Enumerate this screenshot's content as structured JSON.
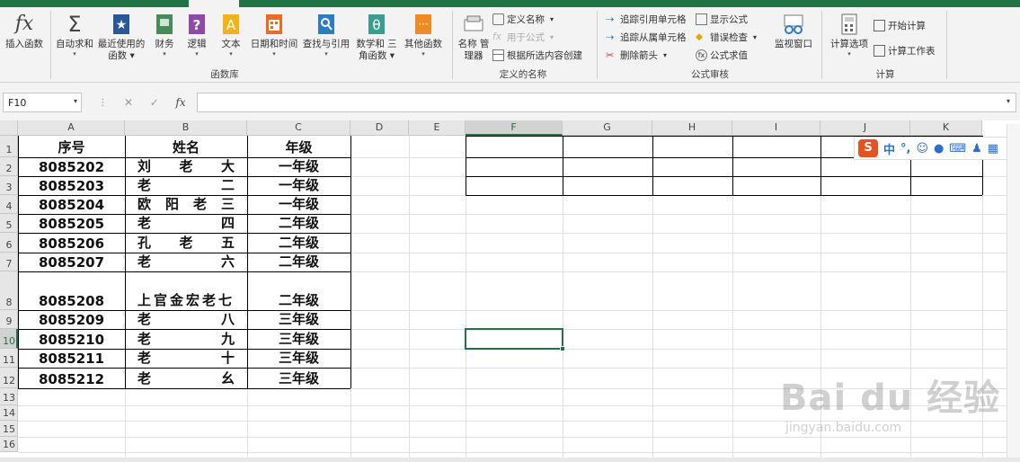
{
  "ribbon": {
    "insert_function": "插入函数",
    "autosum": "自动求和",
    "recent": [
      "最近使用的",
      "函数"
    ],
    "financial": "财务",
    "logical": "逻辑",
    "text": "文本",
    "datetime": "日期和时间",
    "lookup": "查找与引用",
    "math": [
      "数学和",
      "三角函数"
    ],
    "more": "其他函数",
    "group_library": "函数库",
    "name_manager": [
      "名称",
      "管理器"
    ],
    "define_name": "定义名称",
    "use_in_formula": "用于公式",
    "create_from_selection": "根据所选内容创建",
    "group_defined_names": "定义的名称",
    "trace_precedents": "追踪引用单元格",
    "trace_dependents": "追踪从属单元格",
    "remove_arrows": "删除箭头",
    "show_formulas": "显示公式",
    "error_checking": "错误检查",
    "evaluate_formula": "公式求值",
    "watch_window": "监视窗口",
    "group_auditing": "公式审核",
    "calc_options": "计算选项",
    "calc_now": "开始计算",
    "calc_sheet": "计算工作表",
    "group_calc": "计算"
  },
  "formula_bar": {
    "name_box": "F10",
    "cancel": "✕",
    "enter": "✓",
    "fx": "fx",
    "formula": ""
  },
  "sheet": {
    "columns": [
      "A",
      "B",
      "C",
      "D",
      "E",
      "F",
      "G",
      "H",
      "I",
      "J",
      "K"
    ],
    "selected_column": "F",
    "selected_row": "10",
    "rows": [
      "1",
      "2",
      "3",
      "4",
      "5",
      "6",
      "7",
      "8",
      "9",
      "10",
      "11",
      "12",
      "13",
      "14",
      "15",
      "16"
    ],
    "header": {
      "id": "序号",
      "name": "姓名",
      "grade": "年级"
    },
    "data": [
      {
        "id": "8085202",
        "name": [
          "刘",
          "老",
          "大"
        ],
        "grade": "一年级"
      },
      {
        "id": "8085203",
        "name": [
          "老",
          "二"
        ],
        "grade": "一年级"
      },
      {
        "id": "8085204",
        "name": [
          "欧",
          "阳",
          "老",
          "三"
        ],
        "grade": "一年级"
      },
      {
        "id": "8085205",
        "name": [
          "老",
          "四"
        ],
        "grade": "二年级"
      },
      {
        "id": "8085206",
        "name": [
          "孔",
          "老",
          "五"
        ],
        "grade": "二年级"
      },
      {
        "id": "8085207",
        "name": [
          "老",
          "六"
        ],
        "grade": "二年级"
      },
      {
        "id": "8085208",
        "name": [
          "上官金宏老七"
        ],
        "grade": "二年级"
      },
      {
        "id": "8085209",
        "name": [
          "老",
          "八"
        ],
        "grade": "三年级"
      },
      {
        "id": "8085210",
        "name": [
          "老",
          "九"
        ],
        "grade": "三年级"
      },
      {
        "id": "8085211",
        "name": [
          "老",
          "十"
        ],
        "grade": "三年级"
      },
      {
        "id": "8085212",
        "name": [
          "老",
          "幺"
        ],
        "grade": "三年级"
      }
    ]
  },
  "ime": {
    "logo": "S",
    "lang": "中",
    "punct": "°,"
  },
  "watermark": {
    "main": "Bai du 经验",
    "url": "jingyan.baidu.com"
  },
  "colors": {
    "accent": "#217346",
    "ime": "#e8531d"
  }
}
